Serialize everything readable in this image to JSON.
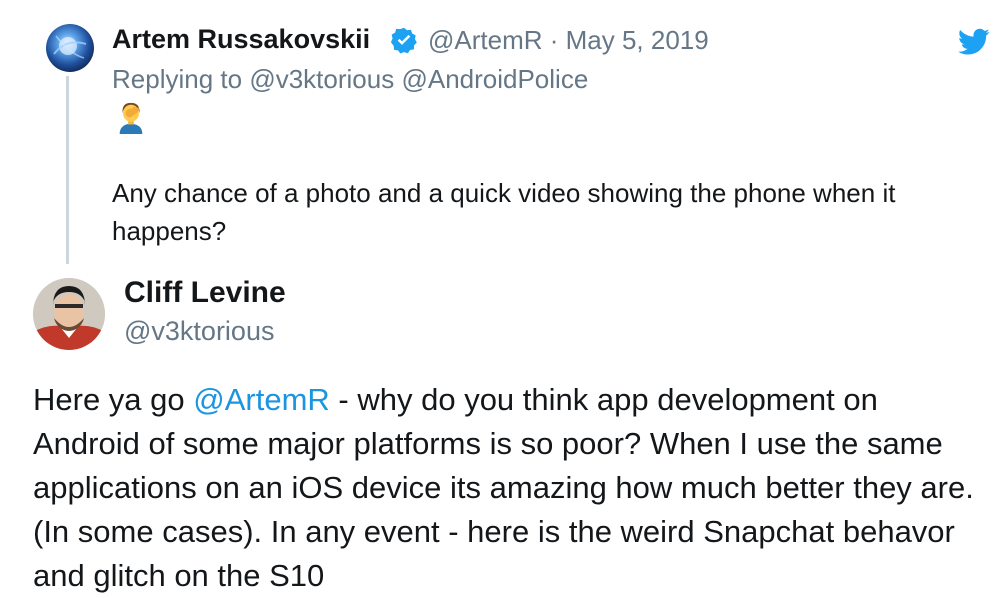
{
  "reply_tweet": {
    "author_name": "Artem Russakovskii",
    "author_handle": "@ArtemR",
    "separator": " · ",
    "date": "May 5, 2019",
    "replying_prefix": "Replying to ",
    "replying_to": [
      "@v3ktorious",
      "@AndroidPolice"
    ],
    "emoji": "🤦‍♂️",
    "text": "Any chance of a photo and a quick video showing the phone when it happens?"
  },
  "main_tweet": {
    "author_name": "Cliff Levine",
    "author_handle": "@v3ktorious",
    "text_prefix": "Here ya go ",
    "text_mention": "@ArtemR",
    "text_body": " - why do you think app development on Android of some major platforms is so poor?  When I use the same applications on an iOS device its amazing how much better they are. (In some cases).  In any event - here is the weird Snapchat behavor and glitch on the S10 "
  },
  "colors": {
    "link": "#1b95e0",
    "verified": "#1da1f2",
    "twitter_brand": "#1da1f2",
    "secondary_text": "#657786",
    "thread_line": "#ccd6dd"
  },
  "icons": {
    "verified": "verified-badge-icon",
    "brand": "twitter-bird-icon",
    "emoji": "facepalm-emoji-icon"
  }
}
